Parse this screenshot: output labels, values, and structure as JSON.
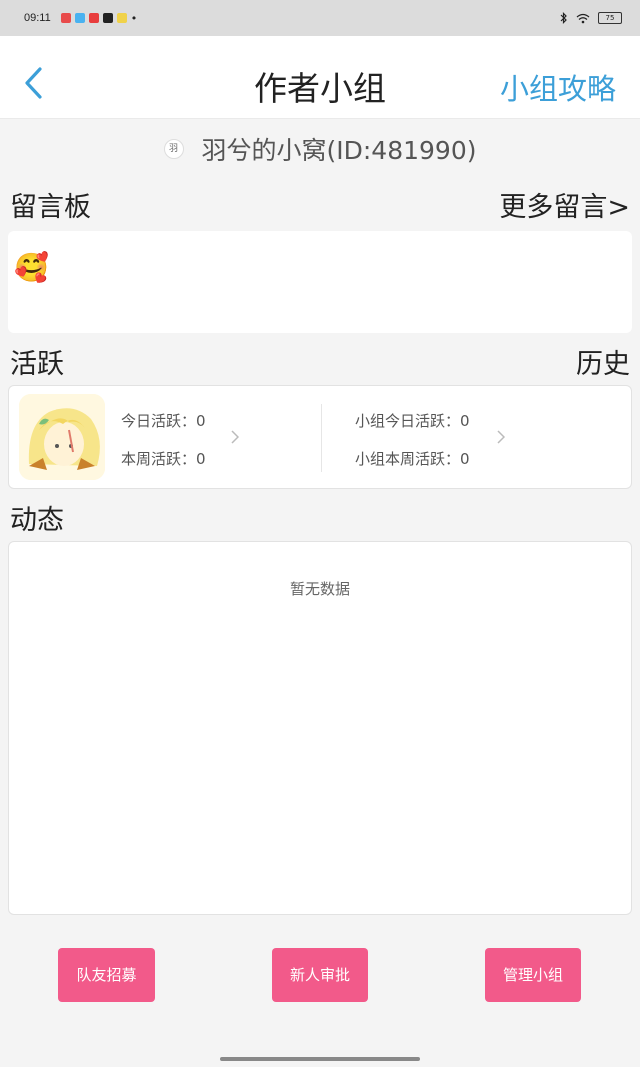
{
  "status_bar": {
    "time": "09:11",
    "battery": "75",
    "dot": "•",
    "app_icons": [
      "#e84b4b",
      "#4ab2f0",
      "#e83d3d",
      "#222222",
      "#f0d24a"
    ]
  },
  "header": {
    "title": "作者小组",
    "guide_link": "小组攻略",
    "accent_color": "#3c9fd8"
  },
  "group": {
    "avatar_text": "羽",
    "name": "羽兮的小窝(ID:481990)"
  },
  "message_board": {
    "title": "留言板",
    "more_link": "更多留言>",
    "messages": [
      "🥰"
    ]
  },
  "activity": {
    "title": "活跃",
    "history_link": "历史",
    "today_label": "今日活跃：0",
    "week_label": "本周活跃：0",
    "group_today_label": "小组今日活跃：0",
    "group_week_label": "小组本周活跃：0"
  },
  "feed": {
    "title": "动态",
    "empty_text": "暂无数据"
  },
  "buttons": {
    "recruit": "队友招募",
    "approve": "新人审批",
    "manage": "管理小组",
    "color": "#f25a8a"
  }
}
